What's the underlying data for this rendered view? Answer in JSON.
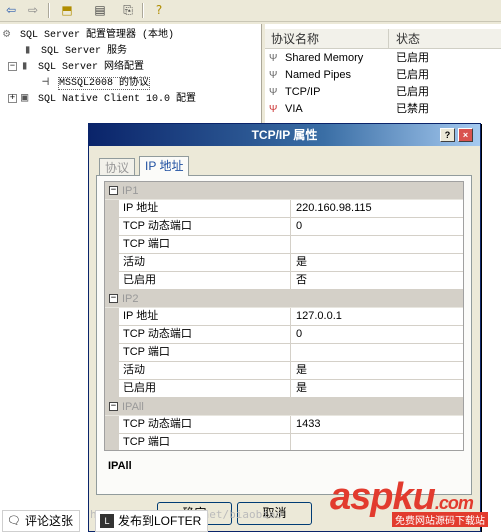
{
  "toolbar": {
    "back_icon": "back-arrow-icon",
    "forward_icon": "forward-arrow-icon",
    "up_icon": "up-folder-icon",
    "properties_icon": "properties-icon",
    "export_icon": "export-list-icon",
    "help_icon": "help-icon"
  },
  "tree": {
    "root": "SQL Server 配置管理器 (本地)",
    "services": "SQL Server 服务",
    "network": "SQL Server 网络配置",
    "instance_protocols": "MSSQL2008 的协议",
    "native_client": "SQL Native Client 10.0 配置"
  },
  "list": {
    "col_name": "协议名称",
    "col_status": "状态",
    "rows": [
      {
        "name": "Shared Memory",
        "status": "已启用"
      },
      {
        "name": "Named Pipes",
        "status": "已启用"
      },
      {
        "name": "TCP/IP",
        "status": "已启用"
      },
      {
        "name": "VIA",
        "status": "已禁用"
      }
    ]
  },
  "dialog": {
    "title": "TCP/IP 属性",
    "help_btn": "?",
    "close_btn": "×",
    "tab_protocol": "协议",
    "tab_ip": "IP 地址",
    "sections": [
      {
        "name": "IP1",
        "rows": [
          {
            "key": "IP 地址",
            "value": "220.160.98.115"
          },
          {
            "key": "TCP 动态端口",
            "value": "0"
          },
          {
            "key": "TCP 端口",
            "value": ""
          },
          {
            "key": "活动",
            "value": "是"
          },
          {
            "key": "已启用",
            "value": "否"
          }
        ]
      },
      {
        "name": "IP2",
        "rows": [
          {
            "key": "IP 地址",
            "value": "127.0.0.1"
          },
          {
            "key": "TCP 动态端口",
            "value": "0"
          },
          {
            "key": "TCP 端口",
            "value": ""
          },
          {
            "key": "活动",
            "value": "是"
          },
          {
            "key": "已启用",
            "value": "是"
          }
        ]
      },
      {
        "name": "IPAll",
        "rows": [
          {
            "key": "TCP 动态端口",
            "value": "1433"
          },
          {
            "key": "TCP 端口",
            "value": ""
          }
        ]
      }
    ],
    "description": "IPAll",
    "ok": "确定",
    "cancel": "取消"
  },
  "bottom": {
    "comment": "评论这张",
    "publish": "发布到LOFTER",
    "url_fragment": "http://blog.csdn.net/biaobiao",
    "watermark": "aspku",
    "watermark_tld": ".com",
    "watermark_sub": "免费网站源码下载站"
  },
  "colors": {
    "titlebar": "#0a246a",
    "watermark": "#e23b2e"
  }
}
